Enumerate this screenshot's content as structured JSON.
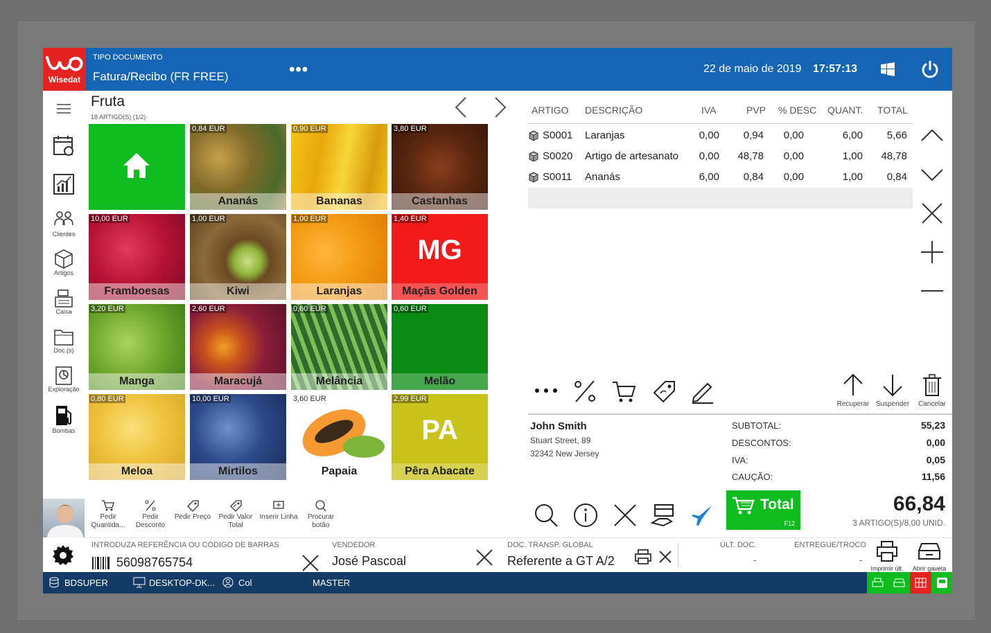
{
  "header": {
    "brand": "Wisedat",
    "doc_label": "TIPO DOCUMENTO",
    "doc_title": "Fatura/Recibo (FR FREE)",
    "menu_dots": "•••",
    "date": "22 de maio de 2019",
    "time": "17:57:13"
  },
  "sidebar": {
    "items": [
      {
        "label": "",
        "icon": "calendar-icon"
      },
      {
        "label": "",
        "icon": "chart-icon"
      },
      {
        "label": "Clientes",
        "icon": "clients-icon"
      },
      {
        "label": "Artigos",
        "icon": "box-icon"
      },
      {
        "label": "Caixa",
        "icon": "cash-register-icon"
      },
      {
        "label": "Doc.(s)",
        "icon": "folder-icon"
      },
      {
        "label": "Exploração",
        "icon": "report-icon"
      },
      {
        "label": "Bombas",
        "icon": "fuel-pump-icon"
      }
    ]
  },
  "category": {
    "title": "Fruta",
    "count": "18 ARTIGO(S) (1/2)"
  },
  "tiles": [
    {
      "name": "",
      "price": "",
      "type": "home"
    },
    {
      "name": "Ananás",
      "price": "0,84 EUR"
    },
    {
      "name": "Bananas",
      "price": "0,90 EUR"
    },
    {
      "name": "Castanhas",
      "price": "3,80 EUR"
    },
    {
      "name": "Framboesas",
      "price": "10,00 EUR"
    },
    {
      "name": "Kiwi",
      "price": "1,00 EUR"
    },
    {
      "name": "Laranjas",
      "price": "1,00 EUR"
    },
    {
      "name": "Maçãs Golden",
      "price": "1,40 EUR",
      "big": "MG"
    },
    {
      "name": "Manga",
      "price": "3,20 EUR"
    },
    {
      "name": "Maracujá",
      "price": "2,60 EUR"
    },
    {
      "name": "Melância",
      "price": "0,60 EUR"
    },
    {
      "name": "Melão",
      "price": "0,60 EUR"
    },
    {
      "name": "Meloa",
      "price": "0,80 EUR"
    },
    {
      "name": "Mirtilos",
      "price": "10,00 EUR"
    },
    {
      "name": "Papaia",
      "price": "3,60 EUR"
    },
    {
      "name": "Pêra Abacate",
      "price": "2,99 EUR",
      "big": "PA"
    }
  ],
  "actions": [
    {
      "label": "Pedir Quantida...",
      "icon": "cart-icon"
    },
    {
      "label": "Pedir Desconto",
      "icon": "percent-icon"
    },
    {
      "label": "Pedir Preço",
      "icon": "tag-icon"
    },
    {
      "label": "Pedir Valor Total",
      "icon": "tag-total-icon"
    },
    {
      "label": "Inserir Linha",
      "icon": "insert-line-icon"
    },
    {
      "label": "Procurar botão",
      "icon": "search-icon"
    }
  ],
  "table": {
    "headers": [
      "ARTIGO",
      "DESCRIÇÃO",
      "IVA",
      "PVP",
      "% DESC",
      "QUANT.",
      "TOTAL"
    ],
    "rows": [
      {
        "code": "S0001",
        "desc": "Laranjas",
        "iva": "0,00",
        "pvp": "0,94",
        "desc_pct": "0,00",
        "qty": "6,00",
        "total": "5,66"
      },
      {
        "code": "S0020",
        "desc": "Artigo de artesanato",
        "iva": "0,00",
        "pvp": "48,78",
        "desc_pct": "0,00",
        "qty": "1,00",
        "total": "48,78"
      },
      {
        "code": "S0011",
        "desc": "Ananás",
        "iva": "6,00",
        "pvp": "0,84",
        "desc_pct": "0,00",
        "qty": "1,00",
        "total": "0,84"
      }
    ]
  },
  "line_actions": {
    "recover": "Recuperar",
    "suspend": "Suspender",
    "cancel": "Cancelar"
  },
  "customer": {
    "name": "John Smith",
    "street": "Stuart Street, 89",
    "city": "32342 New Jersey"
  },
  "totals": {
    "subtotal_label": "SUBTOTAL:",
    "subtotal": "55,23",
    "discounts_label": "DESCONTOS:",
    "discounts": "0,00",
    "iva_label": "IVA:",
    "iva": "0,05",
    "deposit_label": "CAUÇÃO:",
    "deposit": "11,56",
    "total_button": "Total",
    "total_key": "F12",
    "grand_total": "66,84",
    "items_summary": "3 ARTIGO(S)/8,00 UNID."
  },
  "input_strip": {
    "barcode_label": "INTRODUZA REFERÊNCIA OU CÓDIGO DE BARRAS",
    "barcode_value": "56098765754",
    "seller_label": "VENDEDOR",
    "seller_value": "José Pascoal",
    "transport_label": "DOC. TRANSP. GLOBAL",
    "transport_value": "Referente a GT A/2",
    "last_doc_label": "ÚLT. DOC.",
    "last_doc_value": "-",
    "change_label": "ENTREGUE/TROCO",
    "change_value": "-",
    "print_last": "Imprimir últ.",
    "open_drawer": "Abrir gaveta"
  },
  "statusbar": {
    "db": "BDSUPER",
    "machine": "DESKTOP-DK...",
    "user": "Col",
    "role": "MASTER"
  },
  "colors": {
    "header": "#1565b4",
    "brand_red": "#e52421",
    "total_green": "#0fbc1f",
    "statusbar": "#143a66"
  }
}
